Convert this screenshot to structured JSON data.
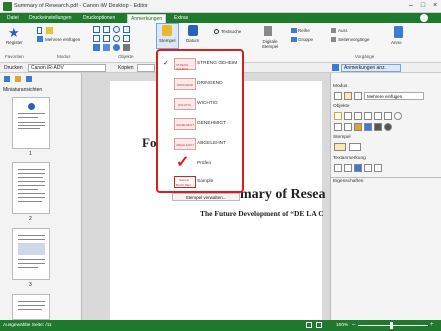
{
  "window": {
    "title": "Summary of Research.pdf - Canon iW Desktop - Editor"
  },
  "tabs": [
    "Datei",
    "Druckeinstellungen",
    "Druckoptionen",
    "Anmerkungen",
    "Extras"
  ],
  "ribbon": {
    "register": "Register",
    "mehrere_einfuegen": "Mehrere einfügen",
    "favoriten": "Favoriten",
    "modus": "Modus",
    "objekte": "Objekte",
    "stempel": "Stempel",
    "datum": "Datum",
    "textsuche": "Textsuche",
    "digitale_stempel": "Digitale Stempel",
    "reihe": "Reihe",
    "gruppe": "Gruppe",
    "ausr": "Ausr.",
    "seitenvorgaenge": "Seitenvorgänge",
    "anno": "Anno",
    "vorgaenge": "Vorgänge"
  },
  "propbar": {
    "drucken": "Drucken",
    "printer": "Canon iR-ADV",
    "kopien": "Kopien",
    "anmerkungen_anz": "Anmerkungen anz."
  },
  "left_panel": {
    "title": "Miniaturansichten",
    "pages": [
      "1",
      "2",
      "3"
    ]
  },
  "document": {
    "heading_left": "Fo",
    "heading_right": "mary of Resea",
    "subheading": "The Future Development of “DE LA C",
    "stamp_rename_button": "Stempel verwalten..."
  },
  "right_panel": {
    "modus": "Modus",
    "mehrere_einfuegen": "Mehrere einfügen",
    "objekte": "Objekte",
    "stempel": "Stempel",
    "textanmerkung": "Textanmerkung",
    "eigenschaften": "Eigenschaften"
  },
  "stamp_menu": {
    "items": [
      {
        "label": "STRENG GEHEIM",
        "checked": true,
        "stamp_text": "STRENG GEHEIM"
      },
      {
        "label": "DRINGEND",
        "checked": false,
        "stamp_text": "DRINGEND"
      },
      {
        "label": "WICHTIG",
        "checked": false,
        "stamp_text": "WICHTIG"
      },
      {
        "label": "GENEHMIGT",
        "checked": false,
        "stamp_text": "GENEHMIGT"
      },
      {
        "label": "ABGELEHNT",
        "checked": false,
        "stamp_text": "ABGELEHNT"
      },
      {
        "label": "Prüfen",
        "checked": false,
        "stamp_text": ""
      },
      {
        "label": "Sample",
        "checked": false,
        "stamp_text": "Sample"
      }
    ],
    "sample_stamp_line1": "Sample",
    "sample_stamp_line2": "BACK.REC"
  },
  "status": {
    "left": "Ausgewählte Seite: /11",
    "zoom": "100%"
  },
  "colors": {
    "accent": "#1f7a2e",
    "highlight": "#d61f1f"
  }
}
